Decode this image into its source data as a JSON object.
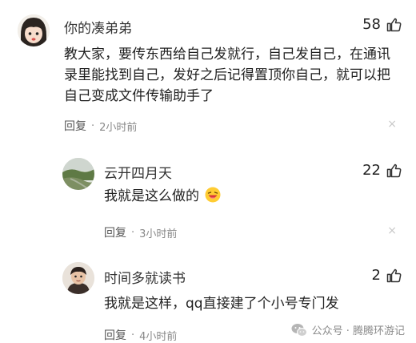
{
  "comments": [
    {
      "name": "你的凑弟弟",
      "likes": "58",
      "lines": [
        "教大家，要传东西给自己发就行，自己发自己，在通讯",
        "录里能找到自己，发好之后记得置顶你自己，就可以把",
        "自己变成文件传输助手了"
      ],
      "reply_label": "回复",
      "time": "2小时前"
    },
    {
      "name": "云开四月天",
      "likes": "22",
      "text": "我就是这么做的",
      "reply_label": "回复",
      "time": "3小时前"
    },
    {
      "name": "时间多就读书",
      "likes": "2",
      "text": "我就是这样，qq直接建了个小号专门发",
      "reply_label": "回复",
      "time": "4小时前"
    }
  ],
  "separator": "·",
  "close_glyph": "×",
  "watermark": "公众号 · 腾腾环游记",
  "icons": {
    "like": "thumbs-up-icon",
    "emoji": "laughing-face-icon",
    "wechat": "wechat-logo-icon"
  }
}
